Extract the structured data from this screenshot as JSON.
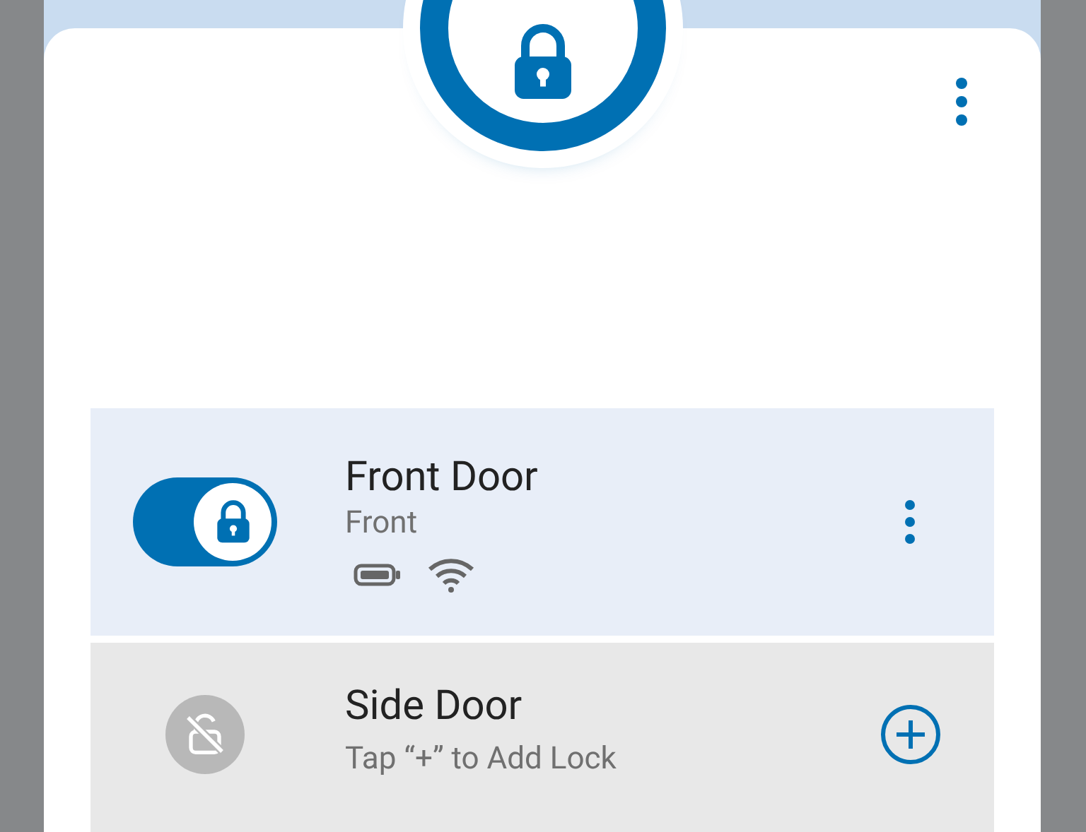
{
  "header": {
    "locked": true
  },
  "locks": [
    {
      "kind": "installed",
      "name": "Front Door",
      "subtitle": "Front",
      "on": true
    },
    {
      "kind": "empty",
      "name": "Side Door",
      "subtitle": "Tap “+” to Add Lock"
    }
  ]
}
